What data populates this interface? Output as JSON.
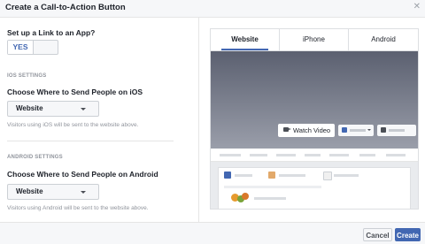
{
  "dialog": {
    "title": "Create a Call-to-Action Button",
    "close_icon": "close-icon"
  },
  "left": {
    "question": "Set up a Link to an App?",
    "toggle": {
      "on_label": "YES"
    },
    "ios": {
      "section_label": "IOS SETTINGS",
      "prompt": "Choose Where to Send People on iOS",
      "selected": "Website",
      "helper": "Visitors using iOS will be sent to the website above."
    },
    "android": {
      "section_label": "ANDROID SETTINGS",
      "prompt": "Choose Where to Send People on Android",
      "selected": "Website",
      "helper": "Visitors using Android will be sent to the website above."
    }
  },
  "preview": {
    "tabs": [
      {
        "label": "Website",
        "active": true
      },
      {
        "label": "iPhone",
        "active": false
      },
      {
        "label": "Android",
        "active": false
      }
    ],
    "watch_button": "Watch Video"
  },
  "footer": {
    "cancel_label": "Cancel",
    "create_label": "Create"
  },
  "colors": {
    "accent": "#4267b2",
    "cover_top": "#5b6070",
    "border": "#dddfe2"
  }
}
